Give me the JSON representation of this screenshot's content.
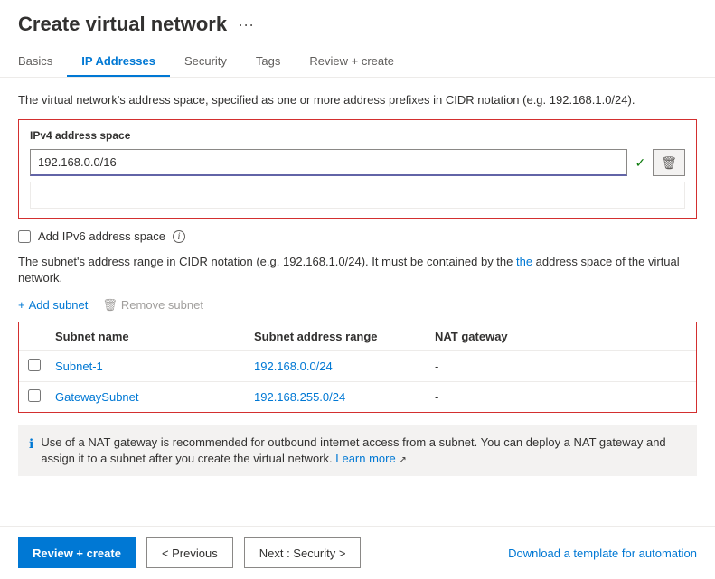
{
  "header": {
    "title": "Create virtual network",
    "ellipsis": "···"
  },
  "tabs": [
    {
      "id": "basics",
      "label": "Basics",
      "active": false
    },
    {
      "id": "ip-addresses",
      "label": "IP Addresses",
      "active": true
    },
    {
      "id": "security",
      "label": "Security",
      "active": false
    },
    {
      "id": "tags",
      "label": "Tags",
      "active": false
    },
    {
      "id": "review-create",
      "label": "Review + create",
      "active": false
    }
  ],
  "content": {
    "description": "The virtual network's address space, specified as one or more address prefixes in CIDR notation (e.g. 192.168.1.0/24).",
    "ipv4_section": {
      "label": "IPv4 address space",
      "value": "192.168.0.0/16"
    },
    "ipv6": {
      "label": "Add IPv6 address space",
      "checked": false
    },
    "subnet_description": "The subnet's address range in CIDR notation (e.g. 192.168.1.0/24). It must be contained by the address space of the virtual network.",
    "subnet_actions": {
      "add": "+ Add subnet",
      "remove": "Remove subnet"
    },
    "subnet_table": {
      "headers": [
        "",
        "Subnet name",
        "Subnet address range",
        "NAT gateway"
      ],
      "rows": [
        {
          "name": "Subnet-1",
          "address": "192.168.0.0/24",
          "nat": "-"
        },
        {
          "name": "GatewaySubnet",
          "address": "192.168.255.0/24",
          "nat": "-"
        }
      ]
    },
    "info_banner": "Use of a NAT gateway is recommended for outbound internet access from a subnet. You can deploy a NAT gateway and assign it to a subnet after you create the virtual network. Learn more"
  },
  "footer": {
    "review_create": "Review + create",
    "previous": "< Previous",
    "next": "Next : Security >",
    "download": "Download a template for automation"
  },
  "icons": {
    "check": "✓",
    "delete": "🗑",
    "info": "i",
    "info_blue": "ℹ",
    "plus": "+",
    "document": "📄"
  }
}
